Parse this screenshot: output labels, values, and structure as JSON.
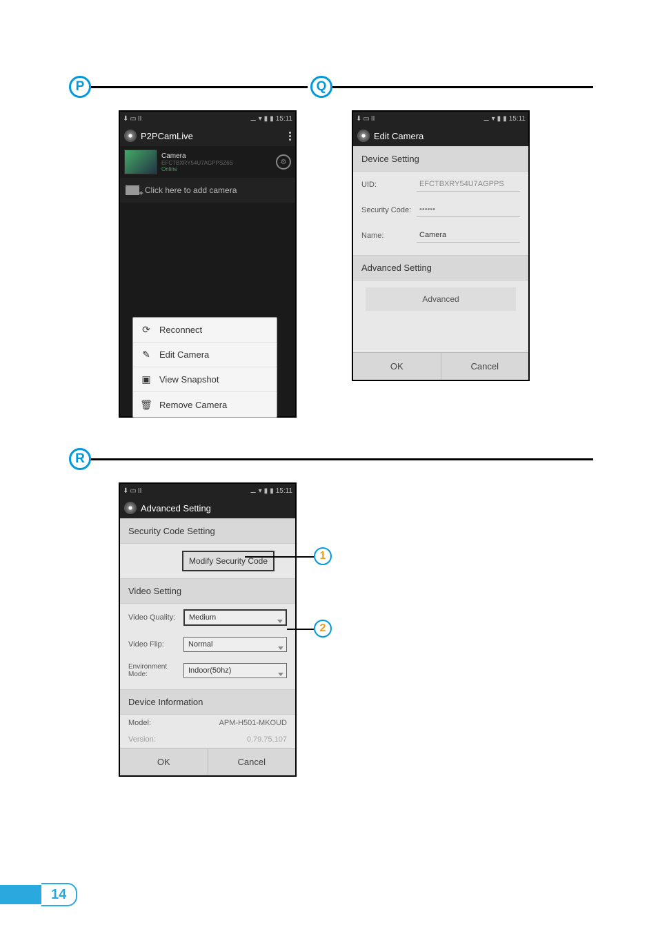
{
  "badges": {
    "P": "P",
    "Q": "Q",
    "R": "R",
    "n1": "1",
    "n2": "2"
  },
  "statusbar": {
    "time": "15:11"
  },
  "screenP": {
    "title": "P2PCamLive",
    "camera": {
      "name": "Camera",
      "uid": "EFCTBXRY54U7AGPPSZ6S",
      "status": "Online"
    },
    "add_label": "Click here to add camera",
    "menu": {
      "reconnect": "Reconnect",
      "edit": "Edit Camera",
      "snapshot": "View Snapshot",
      "remove": "Remove Camera"
    }
  },
  "screenQ": {
    "title": "Edit Camera",
    "device_setting": "Device Setting",
    "uid_label": "UID:",
    "uid_value": "EFCTBXRY54U7AGPPS",
    "sec_label": "Security Code:",
    "sec_value": "••••••",
    "name_label": "Name:",
    "name_value": "Camera",
    "adv_header": "Advanced Setting",
    "adv_button": "Advanced",
    "ok": "OK",
    "cancel": "Cancel"
  },
  "screenR": {
    "title": "Advanced Setting",
    "sec_header": "Security Code Setting",
    "mod_sec": "Modify Security Code",
    "video_header": "Video Setting",
    "vq_label": "Video Quality:",
    "vq_value": "Medium",
    "vf_label": "Video Flip:",
    "vf_value": "Normal",
    "env_label": "Environment Mode:",
    "env_value": "Indoor(50hz)",
    "devinfo_header": "Device Information",
    "model_label": "Model:",
    "model_value": "APM-H501-MKOUD",
    "version_label": "Version:",
    "version_value": "0.79.75.107",
    "ok": "OK",
    "cancel": "Cancel"
  },
  "page_number": "14"
}
